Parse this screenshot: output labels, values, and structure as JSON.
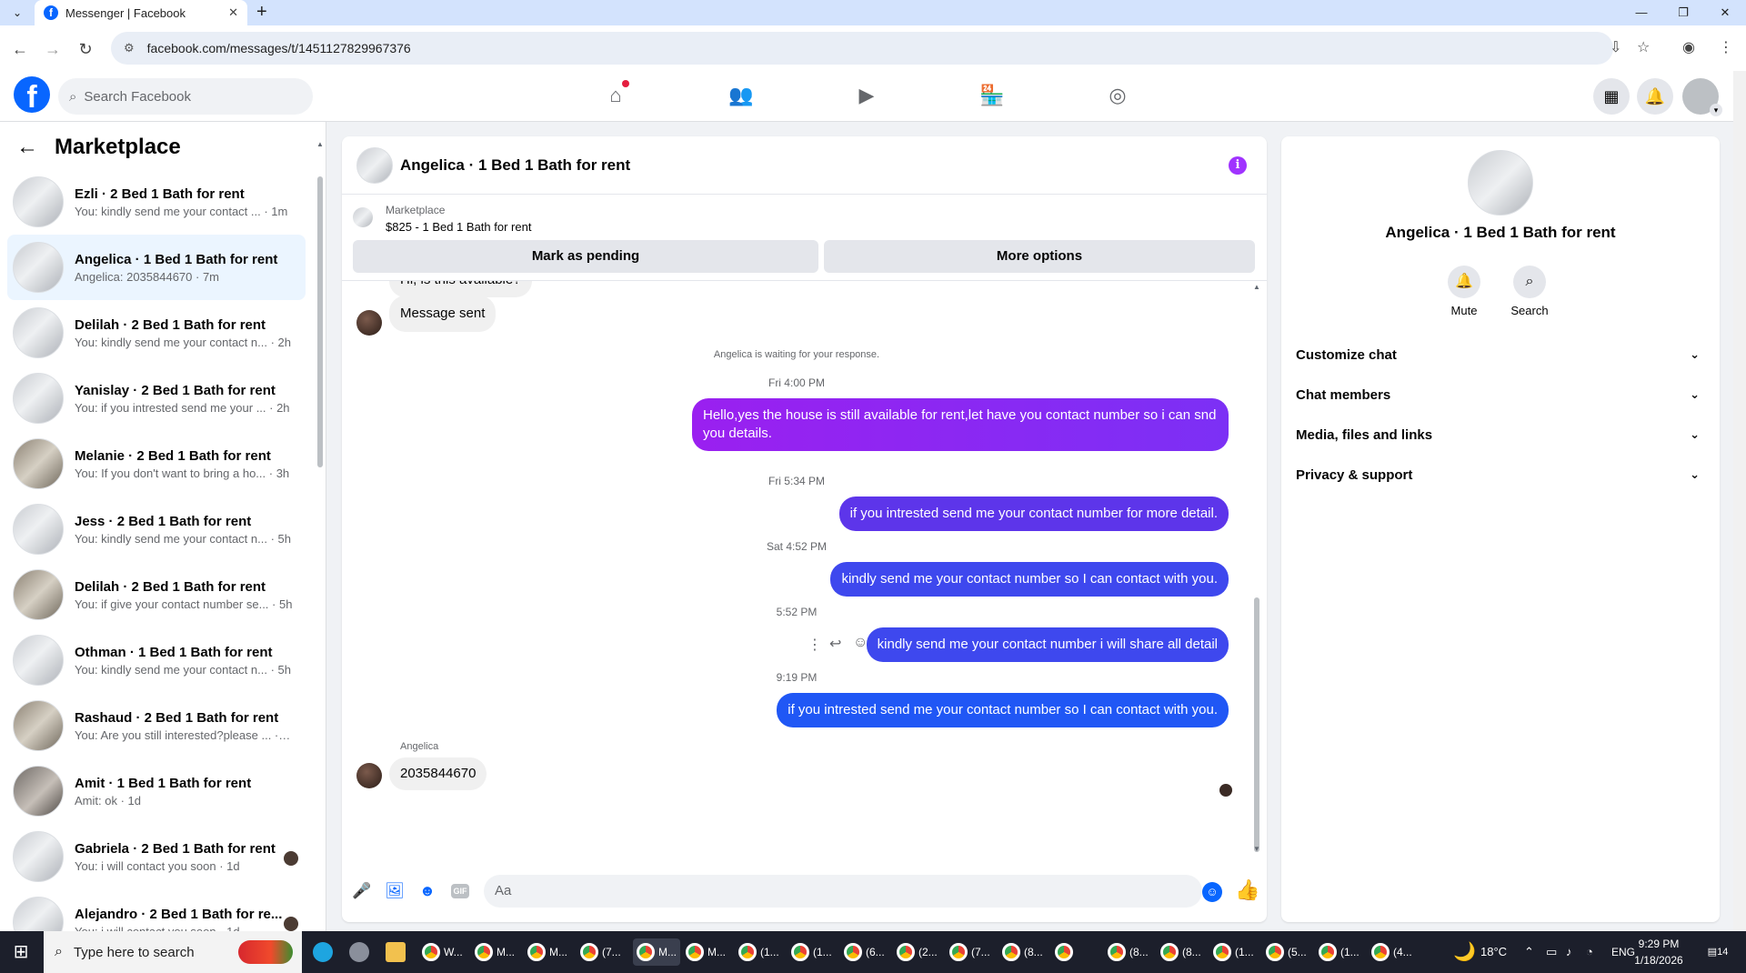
{
  "browser": {
    "tab_title": "Messenger | Facebook",
    "tab_close": "✕",
    "new_tab": "+",
    "url": "facebook.com/messages/t/1451127829967376",
    "window_controls": [
      "—",
      "❐",
      "✕"
    ]
  },
  "fb_header": {
    "search_placeholder": "Search Facebook",
    "nav_icons": [
      "home-icon",
      "friends-icon",
      "video-icon",
      "marketplace-icon",
      "groups-icon"
    ],
    "right_icons": [
      "menu-grid-icon",
      "notifications-icon",
      "profile-icon"
    ]
  },
  "sidebar": {
    "title": "Marketplace",
    "conversations": [
      {
        "name": "Ezli · 2 Bed 1 Bath for rent",
        "preview": "You: kindly send me your contact ... · 1m",
        "avatar": "a"
      },
      {
        "name": "Angelica · 1 Bed 1 Bath for rent",
        "preview": "Angelica: 2035844670 · 7m",
        "avatar": "a",
        "active": true
      },
      {
        "name": "Delilah · 2 Bed 1 Bath for rent",
        "preview": "You: kindly send me your contact n... · 2h",
        "avatar": "a"
      },
      {
        "name": "Yanislay · 2 Bed 1 Bath for rent",
        "preview": "You: if you intrested send me your ... · 2h",
        "avatar": "a"
      },
      {
        "name": "Melanie · 2 Bed 1 Bath for rent",
        "preview": "You: If you don't want to bring a ho... · 3h",
        "avatar": "b"
      },
      {
        "name": "Jess · 2 Bed 1 Bath for rent",
        "preview": "You: kindly send me your contact n... · 5h",
        "avatar": "a"
      },
      {
        "name": "Delilah · 2 Bed 1 Bath for rent",
        "preview": "You: if give your contact number se... · 5h",
        "avatar": "b"
      },
      {
        "name": "Othman · 1 Bed 1 Bath for rent",
        "preview": "You: kindly send me your contact n... · 5h",
        "avatar": "a"
      },
      {
        "name": "Rashaud · 2 Bed 1 Bath for rent",
        "preview": "You: Are you still interested?please ... · 5h",
        "avatar": "b"
      },
      {
        "name": "Amit · 1 Bed 1 Bath for rent",
        "preview": "Amit: ok · 1d",
        "avatar": "d"
      },
      {
        "name": "Gabriela · 2 Bed 1 Bath for rent",
        "preview": "You: i will contact you soon · 1d",
        "avatar": "a",
        "seen": true
      },
      {
        "name": "Alejandro · 2 Bed 1 Bath for re...",
        "preview": "You: i will contact you soon · 1d",
        "avatar": "a",
        "seen": true
      }
    ]
  },
  "chat": {
    "title": "Angelica · 1 Bed 1 Bath for rent",
    "info_icon": "i",
    "listing_source": "Marketplace",
    "listing": "$825 - 1 Bed 1 Bath for rent",
    "mark_pending_label": "Mark as pending",
    "more_options_label": "More options",
    "partial_message": "Hi, is this available?",
    "message_sent": "Message sent",
    "waiting_note": "Angelica is waiting for your response.",
    "messages": [
      {
        "time": "Fri 4:00 PM",
        "text": "Hello,yes the house is still available for rent,let have you contact number so i can snd you details."
      },
      {
        "time": "Fri 5:34 PM",
        "text": "if you intrested send me your contact number for more detail."
      },
      {
        "time": "Sat 4:52 PM",
        "text": "kindly send me your contact number so I can contact with you."
      },
      {
        "time": "5:52 PM",
        "text": "kindly send me your contact number i will share all detail"
      },
      {
        "time": "9:19 PM",
        "text": "if you intrested send me your contact number  so I can contact with you."
      }
    ],
    "sender_name": "Angelica",
    "reply": "2035844670",
    "input_placeholder": "Aa"
  },
  "rpanel": {
    "name": "Angelica · 1 Bed 1 Bath for rent",
    "mute_label": "Mute",
    "search_label": "Search",
    "sections": [
      "Customize chat",
      "Chat members",
      "Media, files and links",
      "Privacy & support"
    ]
  },
  "taskbar": {
    "search_placeholder": "Type here to search",
    "apps": [
      "W...",
      "M...",
      "M...",
      "(7...",
      "M...",
      "M...",
      "(1...",
      "(1...",
      "(6...",
      "(2...",
      "(7...",
      "(8...",
      "",
      "(8...",
      "(8...",
      "(1...",
      "(5...",
      "(1...",
      "(4..."
    ],
    "temperature": "18°C",
    "language": "ENG",
    "time": "9:29 PM",
    "date": "1/18/2026",
    "notifications": "14"
  }
}
